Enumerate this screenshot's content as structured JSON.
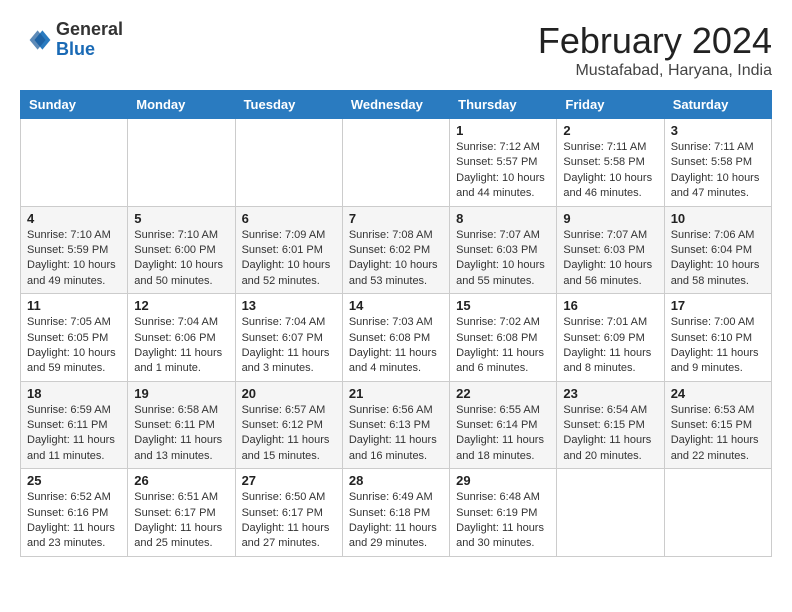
{
  "header": {
    "logo_general": "General",
    "logo_blue": "Blue",
    "month_title": "February 2024",
    "location": "Mustafabad, Haryana, India"
  },
  "weekdays": [
    "Sunday",
    "Monday",
    "Tuesday",
    "Wednesday",
    "Thursday",
    "Friday",
    "Saturday"
  ],
  "weeks": [
    [
      {
        "day": "",
        "info": ""
      },
      {
        "day": "",
        "info": ""
      },
      {
        "day": "",
        "info": ""
      },
      {
        "day": "",
        "info": ""
      },
      {
        "day": "1",
        "info": "Sunrise: 7:12 AM\nSunset: 5:57 PM\nDaylight: 10 hours\nand 44 minutes."
      },
      {
        "day": "2",
        "info": "Sunrise: 7:11 AM\nSunset: 5:58 PM\nDaylight: 10 hours\nand 46 minutes."
      },
      {
        "day": "3",
        "info": "Sunrise: 7:11 AM\nSunset: 5:58 PM\nDaylight: 10 hours\nand 47 minutes."
      }
    ],
    [
      {
        "day": "4",
        "info": "Sunrise: 7:10 AM\nSunset: 5:59 PM\nDaylight: 10 hours\nand 49 minutes."
      },
      {
        "day": "5",
        "info": "Sunrise: 7:10 AM\nSunset: 6:00 PM\nDaylight: 10 hours\nand 50 minutes."
      },
      {
        "day": "6",
        "info": "Sunrise: 7:09 AM\nSunset: 6:01 PM\nDaylight: 10 hours\nand 52 minutes."
      },
      {
        "day": "7",
        "info": "Sunrise: 7:08 AM\nSunset: 6:02 PM\nDaylight: 10 hours\nand 53 minutes."
      },
      {
        "day": "8",
        "info": "Sunrise: 7:07 AM\nSunset: 6:03 PM\nDaylight: 10 hours\nand 55 minutes."
      },
      {
        "day": "9",
        "info": "Sunrise: 7:07 AM\nSunset: 6:03 PM\nDaylight: 10 hours\nand 56 minutes."
      },
      {
        "day": "10",
        "info": "Sunrise: 7:06 AM\nSunset: 6:04 PM\nDaylight: 10 hours\nand 58 minutes."
      }
    ],
    [
      {
        "day": "11",
        "info": "Sunrise: 7:05 AM\nSunset: 6:05 PM\nDaylight: 10 hours\nand 59 minutes."
      },
      {
        "day": "12",
        "info": "Sunrise: 7:04 AM\nSunset: 6:06 PM\nDaylight: 11 hours\nand 1 minute."
      },
      {
        "day": "13",
        "info": "Sunrise: 7:04 AM\nSunset: 6:07 PM\nDaylight: 11 hours\nand 3 minutes."
      },
      {
        "day": "14",
        "info": "Sunrise: 7:03 AM\nSunset: 6:08 PM\nDaylight: 11 hours\nand 4 minutes."
      },
      {
        "day": "15",
        "info": "Sunrise: 7:02 AM\nSunset: 6:08 PM\nDaylight: 11 hours\nand 6 minutes."
      },
      {
        "day": "16",
        "info": "Sunrise: 7:01 AM\nSunset: 6:09 PM\nDaylight: 11 hours\nand 8 minutes."
      },
      {
        "day": "17",
        "info": "Sunrise: 7:00 AM\nSunset: 6:10 PM\nDaylight: 11 hours\nand 9 minutes."
      }
    ],
    [
      {
        "day": "18",
        "info": "Sunrise: 6:59 AM\nSunset: 6:11 PM\nDaylight: 11 hours\nand 11 minutes."
      },
      {
        "day": "19",
        "info": "Sunrise: 6:58 AM\nSunset: 6:11 PM\nDaylight: 11 hours\nand 13 minutes."
      },
      {
        "day": "20",
        "info": "Sunrise: 6:57 AM\nSunset: 6:12 PM\nDaylight: 11 hours\nand 15 minutes."
      },
      {
        "day": "21",
        "info": "Sunrise: 6:56 AM\nSunset: 6:13 PM\nDaylight: 11 hours\nand 16 minutes."
      },
      {
        "day": "22",
        "info": "Sunrise: 6:55 AM\nSunset: 6:14 PM\nDaylight: 11 hours\nand 18 minutes."
      },
      {
        "day": "23",
        "info": "Sunrise: 6:54 AM\nSunset: 6:15 PM\nDaylight: 11 hours\nand 20 minutes."
      },
      {
        "day": "24",
        "info": "Sunrise: 6:53 AM\nSunset: 6:15 PM\nDaylight: 11 hours\nand 22 minutes."
      }
    ],
    [
      {
        "day": "25",
        "info": "Sunrise: 6:52 AM\nSunset: 6:16 PM\nDaylight: 11 hours\nand 23 minutes."
      },
      {
        "day": "26",
        "info": "Sunrise: 6:51 AM\nSunset: 6:17 PM\nDaylight: 11 hours\nand 25 minutes."
      },
      {
        "day": "27",
        "info": "Sunrise: 6:50 AM\nSunset: 6:17 PM\nDaylight: 11 hours\nand 27 minutes."
      },
      {
        "day": "28",
        "info": "Sunrise: 6:49 AM\nSunset: 6:18 PM\nDaylight: 11 hours\nand 29 minutes."
      },
      {
        "day": "29",
        "info": "Sunrise: 6:48 AM\nSunset: 6:19 PM\nDaylight: 11 hours\nand 30 minutes."
      },
      {
        "day": "",
        "info": ""
      },
      {
        "day": "",
        "info": ""
      }
    ]
  ]
}
